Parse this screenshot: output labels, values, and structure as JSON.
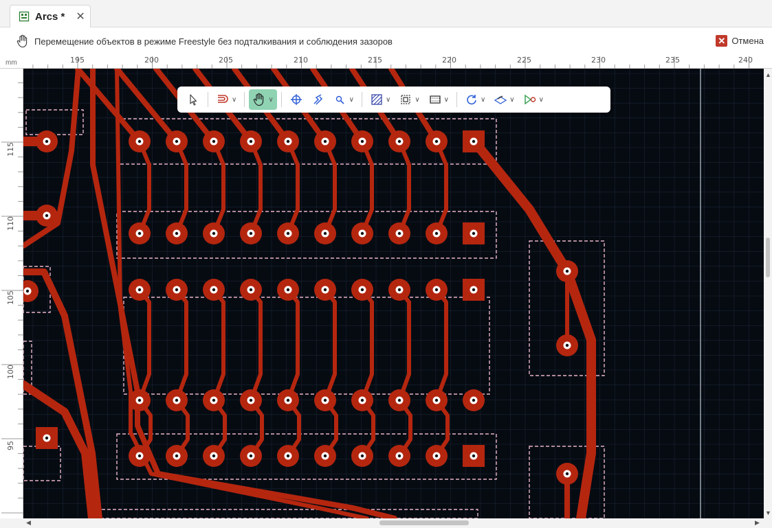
{
  "tab": {
    "title": "Arcs *",
    "close_glyph": "✕",
    "icon": "pcb-document-icon"
  },
  "status": {
    "text": "Перемещение объектов в режиме Freestyle без подталкивания и соблюдения зазоров",
    "icon": "hand-icon",
    "cancel_label": "Отмена"
  },
  "ruler": {
    "unit": "mm",
    "x_ticks": [
      "195",
      "200",
      "205",
      "210",
      "215",
      "220",
      "225",
      "230",
      "235",
      "240"
    ],
    "y_ticks": [
      "115",
      "110",
      "105",
      "100",
      "95"
    ]
  },
  "toolbar": {
    "tools": [
      {
        "icon": "select-arrow-icon"
      },
      {
        "icon": "route-icon",
        "dropdown": true
      },
      {
        "icon": "hand-move-icon",
        "dropdown": true,
        "active": true
      },
      {
        "icon": "crosshair-icon"
      },
      {
        "icon": "interactive-route-icon"
      },
      {
        "icon": "inspect-icon",
        "dropdown": true
      },
      {
        "icon": "polygon-fill-icon",
        "dropdown": true
      },
      {
        "icon": "component-outline-icon",
        "dropdown": true
      },
      {
        "icon": "package-icon",
        "dropdown": true
      },
      {
        "icon": "refresh-icon",
        "dropdown": true
      },
      {
        "icon": "layers-icon",
        "dropdown": true
      },
      {
        "icon": "run-drc-icon",
        "dropdown": true
      }
    ]
  },
  "colors": {
    "board_background": "#060b12",
    "copper": "#b5260f",
    "outline": "#e8b4c8",
    "active_tool": "#8fd3b3",
    "cancel": "#c0392b"
  },
  "pads": {
    "row_1_labels": [
      "",
      "",
      "",
      "",
      "",
      "",
      "",
      "",
      "",
      ""
    ],
    "pad_marker": "1"
  }
}
